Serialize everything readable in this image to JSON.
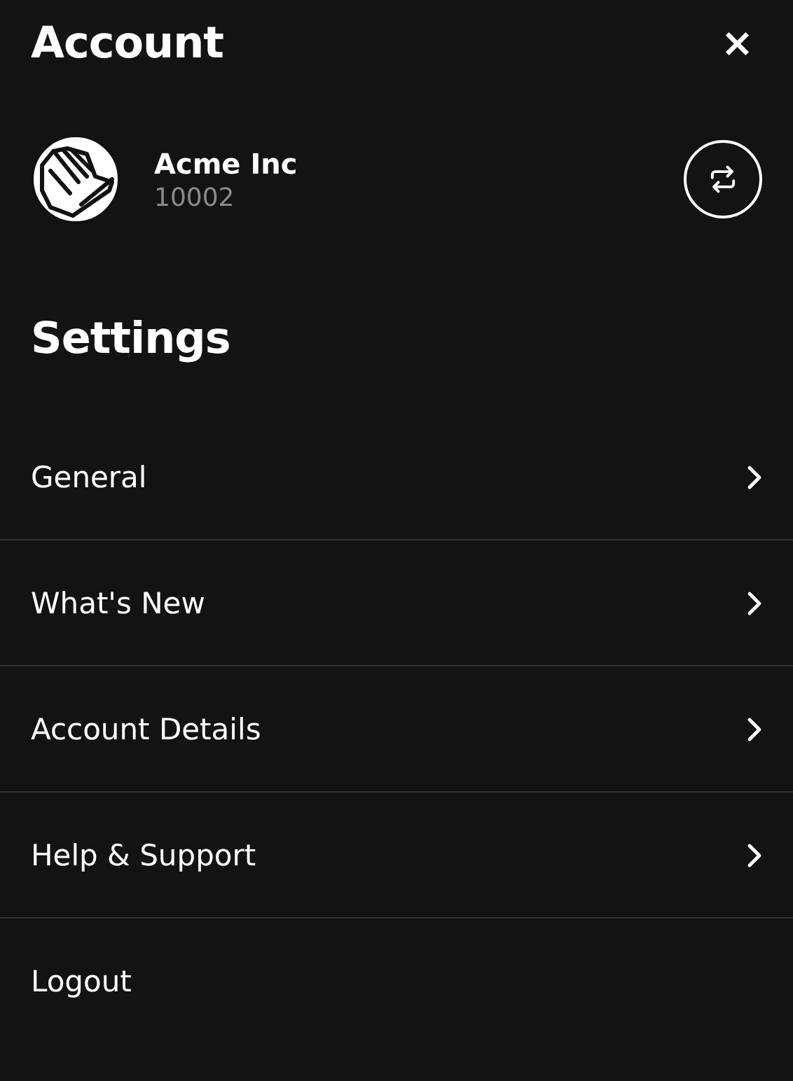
{
  "header": {
    "title": "Account",
    "close": "×"
  },
  "account": {
    "name": "Acme Inc",
    "id": "10002"
  },
  "settings": {
    "title": "Settings",
    "items": [
      {
        "label": "General",
        "kind": "nav"
      },
      {
        "label": "What's New",
        "kind": "nav"
      },
      {
        "label": "Account Details",
        "kind": "nav"
      },
      {
        "label": "Help & Support",
        "kind": "nav"
      },
      {
        "label": "Logout",
        "kind": "action"
      }
    ]
  }
}
